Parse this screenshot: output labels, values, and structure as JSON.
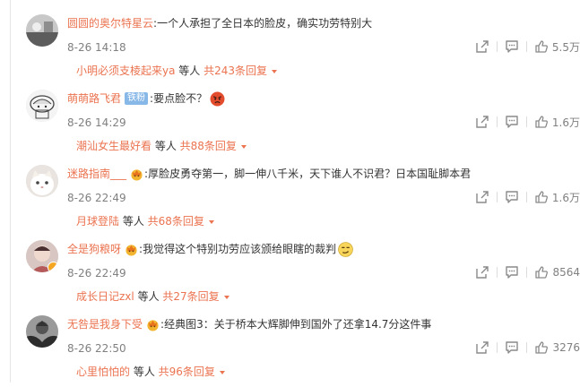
{
  "comments": [
    {
      "username": "圆圆的奥尔特星云",
      "colon": ":",
      "text": "一个人承担了全日本的脸皮，确实功劳特别大",
      "time": "8-26 14:18",
      "likes": "5.5万",
      "reply_user": "小明必须支棱起来ya",
      "reply_etc": " 等人 ",
      "reply_total": "共243条回复"
    },
    {
      "username": "萌萌路飞君",
      "badge": "铁粉",
      "colon": ":",
      "text": "要点脸不？",
      "time": "8-26 14:29",
      "likes": "1.6万",
      "reply_user": "潮汕女生最好看",
      "reply_etc": " 等人 ",
      "reply_total": "共88条回复"
    },
    {
      "username": "迷路指南___",
      "colon": ":",
      "text": "厚脸皮勇夺第一，脚一伸八千米，天下谁人不识君？日本国耻脚本君",
      "time": "8-26 22:49",
      "likes": "1.6万",
      "reply_user": "月球登陆",
      "reply_etc": " 等人 ",
      "reply_total": "共68条回复"
    },
    {
      "username": "全是狗粮呀",
      "colon": ":",
      "text": "我觉得这个特别功劳应该颁给眼瞎的裁判",
      "time": "8-26 22:49",
      "likes": "8564",
      "reply_user": "成长日记zxl",
      "reply_etc": " 等人 ",
      "reply_total": "共27条回复"
    },
    {
      "username": "无咎是我身下受",
      "colon": ":",
      "text": "经典图3：关于桥本大辉脚伸到国外了还拿14.7分这件事",
      "time": "8-26 22:50",
      "likes": "3276",
      "reply_user": "心里怕怕的",
      "reply_etc": " 等人 ",
      "reply_total": "共96条回复"
    }
  ],
  "colors": {
    "username": "#eb7350",
    "text": "#333333",
    "meta": "#808080",
    "icon": "#8a8a8a"
  }
}
